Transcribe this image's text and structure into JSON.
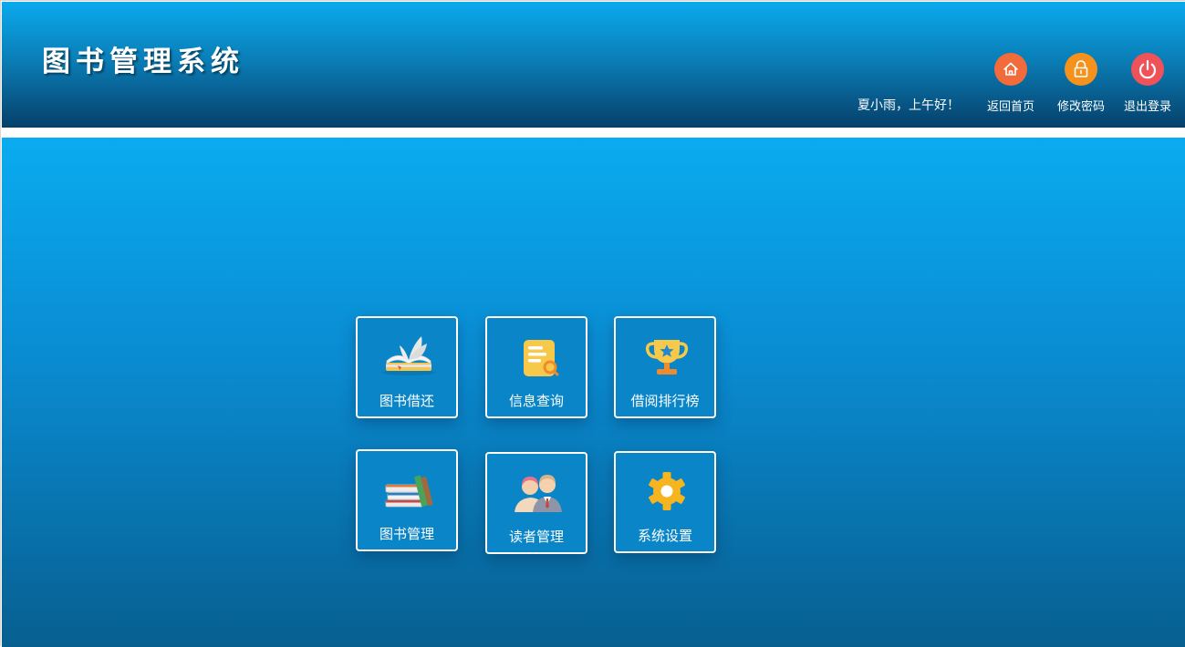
{
  "header": {
    "title": "图书管理系统",
    "greeting": "夏小雨，上午好！",
    "nav": [
      {
        "label": "返回首页",
        "icon": "home-icon",
        "color": "#f26b3a"
      },
      {
        "label": "修改密码",
        "icon": "lock-icon",
        "color": "#f5921e"
      },
      {
        "label": "退出登录",
        "icon": "power-icon",
        "color": "#f0525a"
      }
    ]
  },
  "tiles": [
    {
      "label": "图书借还",
      "icon": "open-book-icon"
    },
    {
      "label": "信息查询",
      "icon": "document-search-icon"
    },
    {
      "label": "借阅排行榜",
      "icon": "trophy-icon"
    },
    {
      "label": "图书管理",
      "icon": "book-stack-icon"
    },
    {
      "label": "读者管理",
      "icon": "readers-icon"
    },
    {
      "label": "系统设置",
      "icon": "gear-icon"
    }
  ],
  "colors": {
    "header_top": "#0aaaee",
    "header_bottom": "#06406a",
    "main_top": "#0aabf0",
    "main_bottom": "#075f90",
    "tile_bg": "#0a86c8"
  }
}
